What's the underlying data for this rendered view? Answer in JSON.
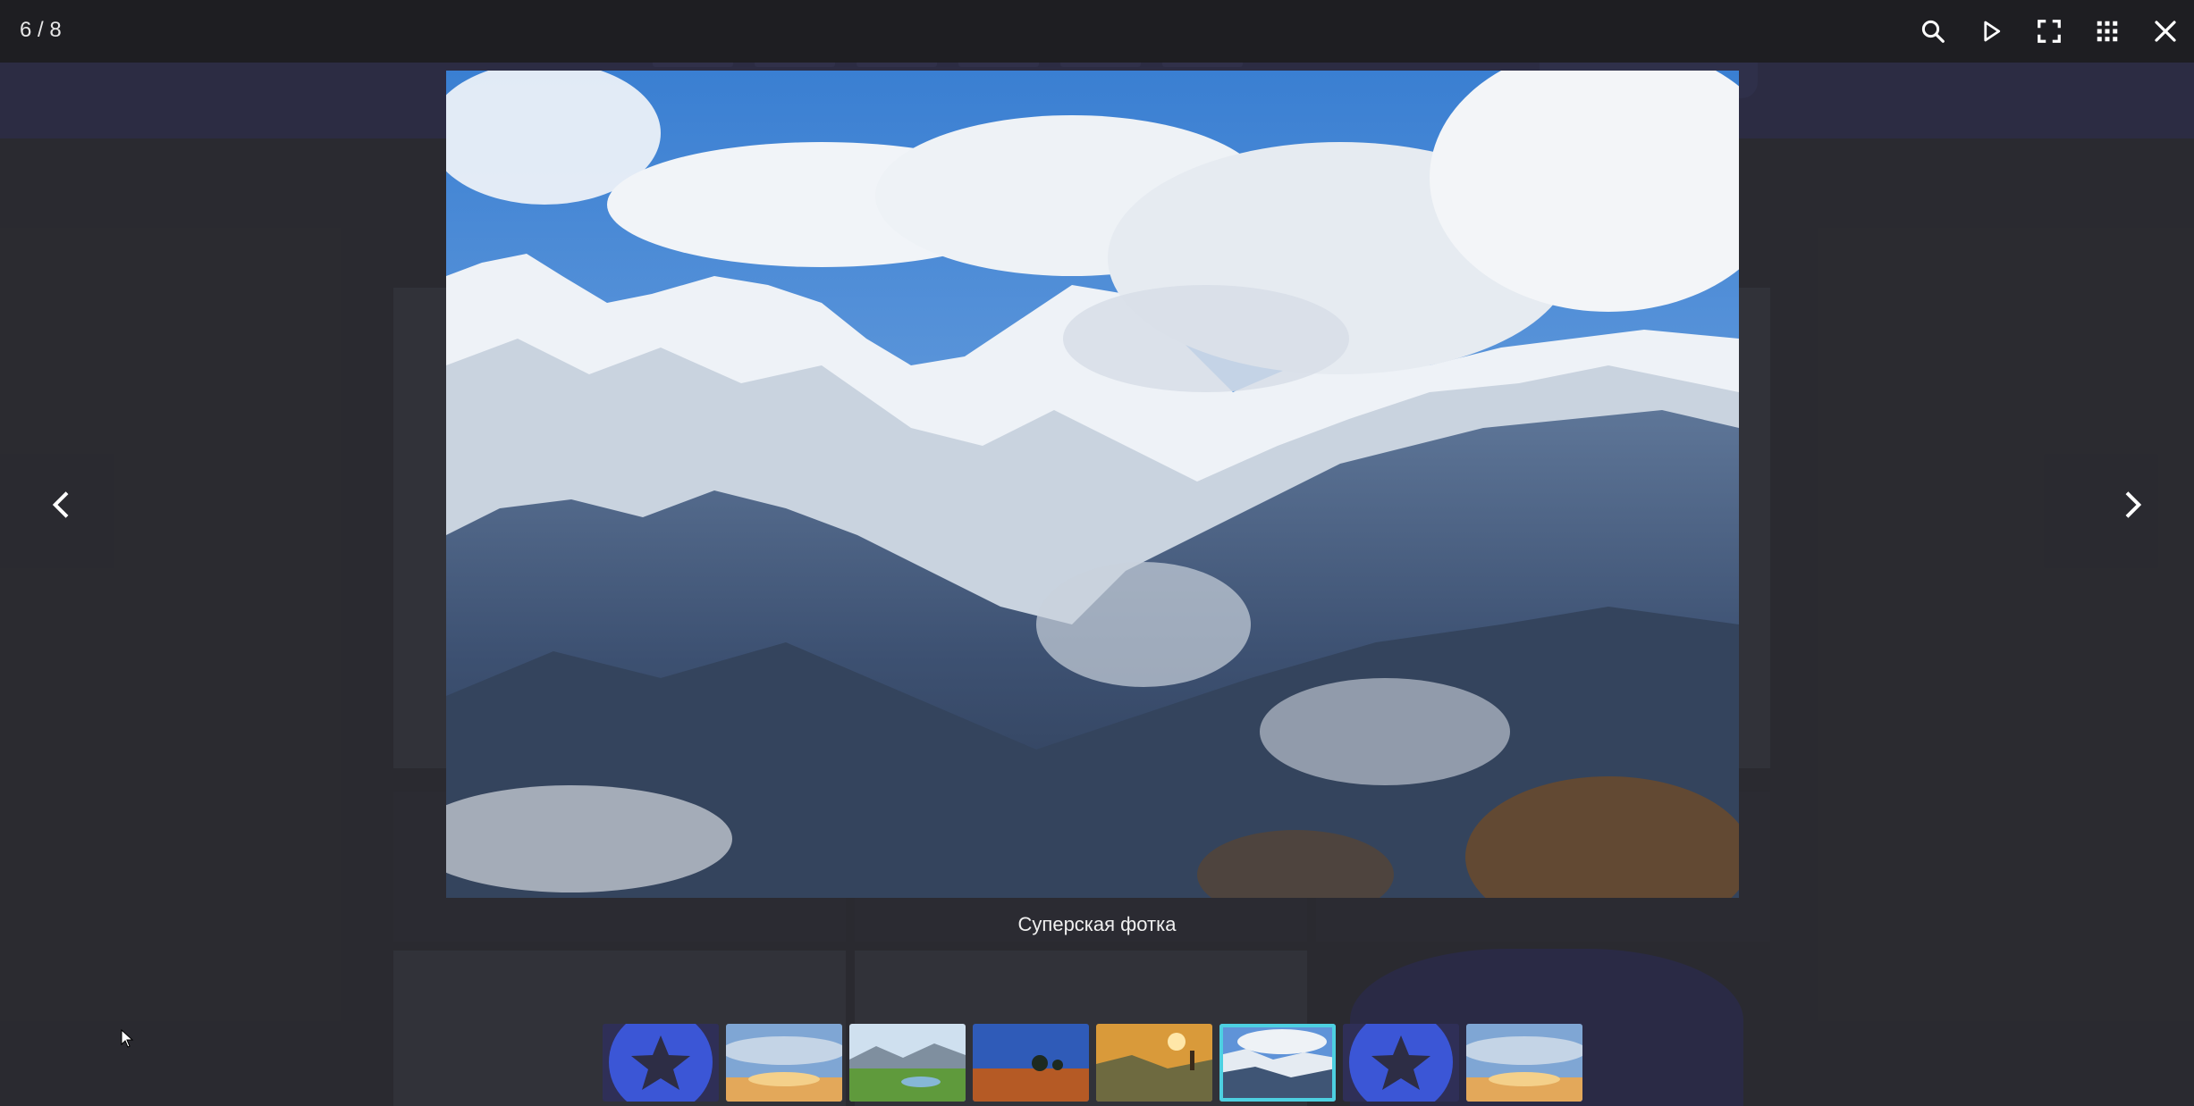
{
  "viewer": {
    "counter": "6 / 8",
    "caption": "Суперская фотка"
  },
  "toolbar": {
    "items": [
      {
        "name": "zoom",
        "icon": "search-icon"
      },
      {
        "name": "slideshow",
        "icon": "play-icon"
      },
      {
        "name": "fullscreen",
        "icon": "fullscreen-icon"
      },
      {
        "name": "thumbnails",
        "icon": "grid-icon"
      },
      {
        "name": "close",
        "icon": "close-icon"
      }
    ]
  },
  "navigation": {
    "prev_icon": "chevron-left-icon",
    "next_icon": "chevron-right-icon"
  },
  "thumbnails": [
    {
      "type": "star-placeholder",
      "active": false
    },
    {
      "type": "sunset-sky",
      "active": false
    },
    {
      "type": "green-valley",
      "active": false
    },
    {
      "type": "field-trees",
      "active": false
    },
    {
      "type": "golden-hills",
      "active": false
    },
    {
      "type": "snowy-mountains",
      "active": true
    },
    {
      "type": "star-placeholder",
      "active": false
    },
    {
      "type": "sunset-sky",
      "active": false
    }
  ],
  "colors": {
    "topbar": "#1e1e22",
    "active_thumb_border": "#4dd0e1",
    "star_circle": "#3b56d6",
    "star": "#2d2d45"
  }
}
